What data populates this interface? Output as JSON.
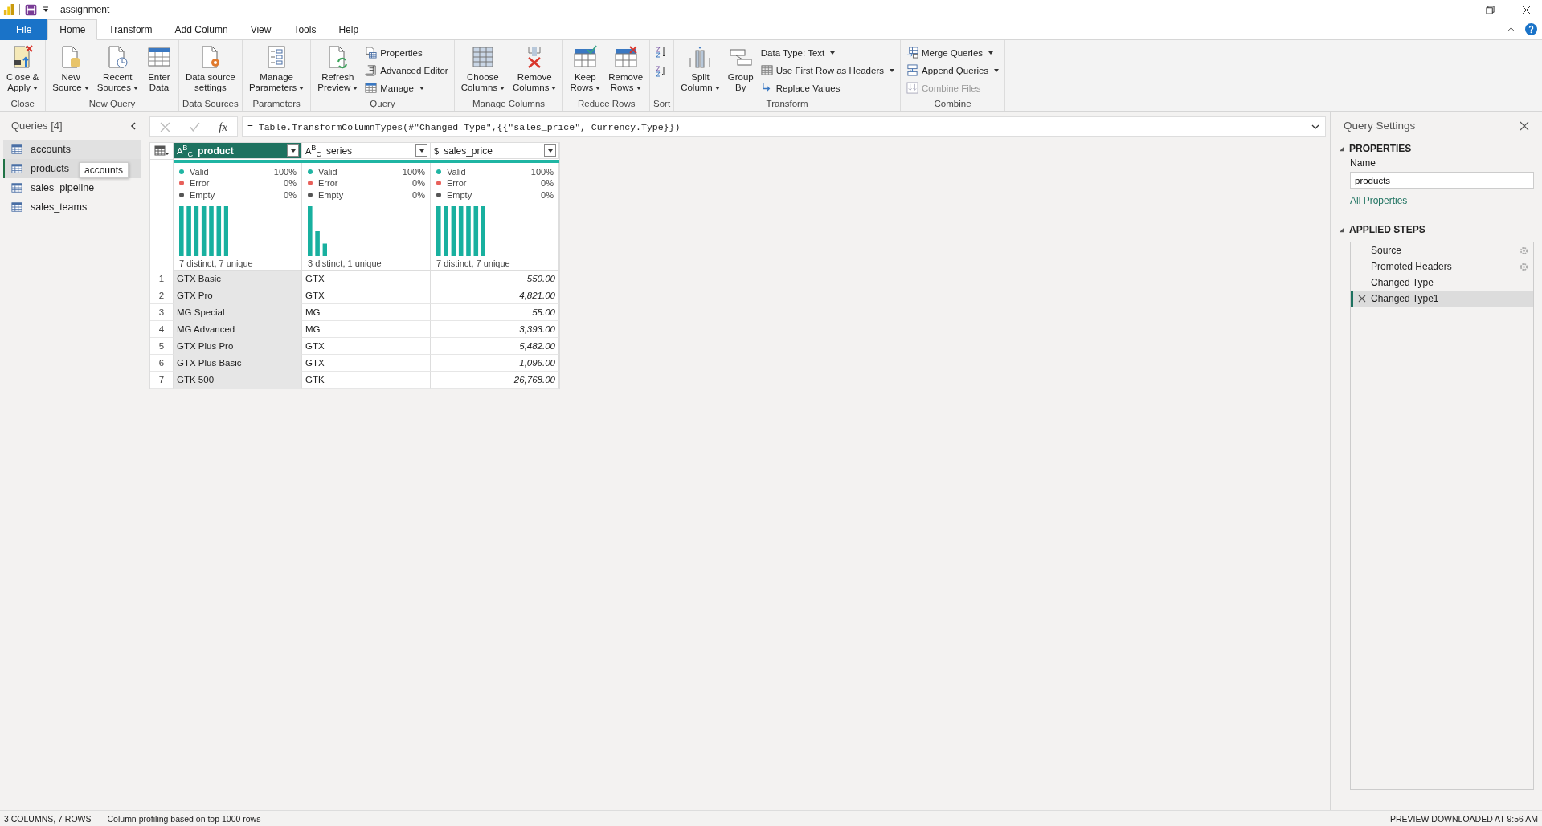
{
  "window": {
    "title": "assignment"
  },
  "menu_tabs": [
    {
      "label": "File",
      "kind": "file",
      "selected": false
    },
    {
      "label": "Home",
      "kind": "tab",
      "selected": true
    },
    {
      "label": "Transform",
      "kind": "tab",
      "selected": false
    },
    {
      "label": "Add Column",
      "kind": "tab",
      "selected": false
    },
    {
      "label": "View",
      "kind": "tab",
      "selected": false
    },
    {
      "label": "Tools",
      "kind": "tab",
      "selected": false
    },
    {
      "label": "Help",
      "kind": "tab",
      "selected": false
    }
  ],
  "ribbon": {
    "groups": [
      {
        "label": "Close",
        "buttons": [
          {
            "kind": "large",
            "label": "Close &\nApply",
            "dropdown": true,
            "disabled": false
          }
        ]
      },
      {
        "label": "New Query",
        "buttons": [
          {
            "kind": "large",
            "label": "New\nSource",
            "dropdown": true,
            "disabled": false
          },
          {
            "kind": "large",
            "label": "Recent\nSources",
            "dropdown": true,
            "disabled": false
          },
          {
            "kind": "large",
            "label": "Enter\nData",
            "dropdown": false,
            "disabled": false
          }
        ]
      },
      {
        "label": "Data Sources",
        "buttons": [
          {
            "kind": "large",
            "label": "Data source\nsettings",
            "dropdown": false,
            "disabled": false
          }
        ]
      },
      {
        "label": "Parameters",
        "buttons": [
          {
            "kind": "large",
            "label": "Manage\nParameters",
            "dropdown": true,
            "disabled": false
          }
        ]
      },
      {
        "label": "Query",
        "buttons": [
          {
            "kind": "large",
            "label": "Refresh\nPreview",
            "dropdown": true,
            "disabled": false
          },
          {
            "kind": "small",
            "label": "Properties",
            "dropdown": false,
            "disabled": false
          },
          {
            "kind": "small",
            "label": "Advanced Editor",
            "dropdown": false,
            "disabled": false
          },
          {
            "kind": "small",
            "label": "Manage",
            "dropdown": true,
            "disabled": false
          }
        ]
      },
      {
        "label": "Manage Columns",
        "buttons": [
          {
            "kind": "large",
            "label": "Choose\nColumns",
            "dropdown": true,
            "disabled": false
          },
          {
            "kind": "large",
            "label": "Remove\nColumns",
            "dropdown": true,
            "disabled": false
          }
        ]
      },
      {
        "label": "Reduce Rows",
        "buttons": [
          {
            "kind": "large",
            "label": "Keep\nRows",
            "dropdown": true,
            "disabled": false
          },
          {
            "kind": "large",
            "label": "Remove\nRows",
            "dropdown": true,
            "disabled": false
          }
        ]
      },
      {
        "label": "Sort",
        "buttons": [
          {
            "kind": "sort"
          },
          {
            "kind": "sort"
          }
        ]
      },
      {
        "label": "Transform",
        "buttons": [
          {
            "kind": "large",
            "label": "Split\nColumn",
            "dropdown": true,
            "disabled": false
          },
          {
            "kind": "large",
            "label": "Group\nBy",
            "dropdown": false,
            "disabled": false
          },
          {
            "kind": "plain",
            "label": "Data Type: Text",
            "dropdown": true,
            "disabled": false
          },
          {
            "kind": "small",
            "label": "Use First Row as Headers",
            "dropdown": true,
            "disabled": false
          },
          {
            "kind": "small",
            "label": "Replace Values",
            "dropdown": false,
            "disabled": false
          }
        ]
      },
      {
        "label": "Combine",
        "buttons": [
          {
            "kind": "small",
            "label": "Merge Queries",
            "dropdown": true,
            "disabled": false
          },
          {
            "kind": "small",
            "label": "Append Queries",
            "dropdown": true,
            "disabled": false
          },
          {
            "kind": "small",
            "label": "Combine Files",
            "dropdown": false,
            "disabled": true
          }
        ]
      }
    ]
  },
  "queries": {
    "title": "Queries [4]",
    "tooltip": "accounts",
    "items": [
      {
        "label": "accounts",
        "selected": false,
        "hovered": true
      },
      {
        "label": "products",
        "selected": true,
        "hovered": false
      },
      {
        "label": "sales_pipeline",
        "selected": false,
        "hovered": false
      },
      {
        "label": "sales_teams",
        "selected": false,
        "hovered": false
      }
    ]
  },
  "formula_bar": {
    "fx": "fx",
    "formula": "= Table.TransformColumnTypes(#\"Changed Type\",{{\"sales_price\", Currency.Type}})"
  },
  "grid": {
    "columns": [
      {
        "name": "product",
        "type_label": "A$^{B}$$_{C}$",
        "kind": "text",
        "selected": true,
        "quality": [
          {
            "label": "Valid",
            "value": "100%",
            "color": "#1fb5a3"
          },
          {
            "label": "Error",
            "value": "0%",
            "color": "#e8605a"
          },
          {
            "label": "Empty",
            "value": "0%",
            "color": "#555555"
          }
        ],
        "distribution": "7 distinct, 7 unique"
      },
      {
        "name": "series",
        "type_label": "A$^{B}$$_{C}$",
        "kind": "text",
        "selected": false,
        "quality": [
          {
            "label": "Valid",
            "value": "100%",
            "color": "#1fb5a3"
          },
          {
            "label": "Error",
            "value": "0%",
            "color": "#e8605a"
          },
          {
            "label": "Empty",
            "value": "0%",
            "color": "#555555"
          }
        ],
        "distribution": "3 distinct, 1 unique"
      },
      {
        "name": "sales_price",
        "type_label": "$",
        "kind": "number",
        "selected": false,
        "quality": [
          {
            "label": "Valid",
            "value": "100%",
            "color": "#1fb5a3"
          },
          {
            "label": "Error",
            "value": "0%",
            "color": "#e8605a"
          },
          {
            "label": "Empty",
            "value": "0%",
            "color": "#555555"
          }
        ],
        "distribution": "7 distinct, 7 unique"
      }
    ],
    "rows": [
      {
        "number": "1",
        "cells": [
          "GTX Basic",
          "GTX",
          "550.00"
        ]
      },
      {
        "number": "2",
        "cells": [
          "GTX Pro",
          "GTX",
          "4,821.00"
        ]
      },
      {
        "number": "3",
        "cells": [
          "MG Special",
          "MG",
          "55.00"
        ]
      },
      {
        "number": "4",
        "cells": [
          "MG Advanced",
          "MG",
          "3,393.00"
        ]
      },
      {
        "number": "5",
        "cells": [
          "GTX Plus Pro",
          "GTX",
          "5,482.00"
        ]
      },
      {
        "number": "6",
        "cells": [
          "GTX Plus Basic",
          "GTX",
          "1,096.00"
        ]
      },
      {
        "number": "7",
        "cells": [
          "GTK 500",
          "GTK",
          "26,768.00"
        ]
      }
    ]
  },
  "query_settings": {
    "title": "Query Settings",
    "properties": {
      "heading": "PROPERTIES",
      "name_label": "Name",
      "name_value": "products",
      "link": "All Properties"
    },
    "applied_steps": {
      "heading": "APPLIED STEPS",
      "steps": [
        {
          "label": "Source",
          "has_settings": true,
          "selected": false
        },
        {
          "label": "Promoted Headers",
          "has_settings": true,
          "selected": false
        },
        {
          "label": "Changed Type",
          "has_settings": false,
          "selected": false
        },
        {
          "label": "Changed Type1",
          "has_settings": false,
          "selected": true
        }
      ]
    }
  },
  "status_bar": {
    "counts": "3 COLUMNS, 7 ROWS",
    "profiling": "Column profiling based on top 1000 rows",
    "preview": "PREVIEW DOWNLOADED AT 9:56 AM"
  }
}
